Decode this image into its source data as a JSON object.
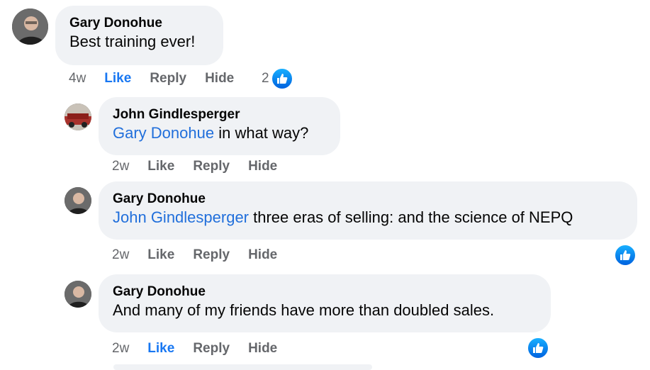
{
  "comments": [
    {
      "author": "Gary Donohue",
      "mention": "",
      "text": "Best training ever!",
      "time": "4w",
      "like_label": "Like",
      "reply_label": "Reply",
      "hide_label": "Hide",
      "reaction_count": "2",
      "liked": true
    },
    {
      "author": "John Gindlesperger",
      "mention": "Gary Donohue",
      "text": " in what way?",
      "time": "2w",
      "like_label": "Like",
      "reply_label": "Reply",
      "hide_label": "Hide",
      "reaction_count": "",
      "liked": false
    },
    {
      "author": "Gary Donohue",
      "mention": "John Gindlesperger",
      "text": " three eras of selling: and the science of NEPQ",
      "time": "2w",
      "like_label": "Like",
      "reply_label": "Reply",
      "hide_label": "Hide",
      "reaction_count": "",
      "liked": false
    },
    {
      "author": "Gary Donohue",
      "mention": "",
      "text": "And many of my friends have more than doubled sales.",
      "time": "2w",
      "like_label": "Like",
      "reply_label": "Reply",
      "hide_label": "Hide",
      "reaction_count": "",
      "liked": true
    }
  ],
  "icons": {
    "reaction": "like-reaction-icon",
    "avatar": "avatar"
  },
  "colors": {
    "accent": "#1877f2",
    "mention": "#216fdb",
    "bubble": "#f0f2f5",
    "meta": "#65676b"
  }
}
